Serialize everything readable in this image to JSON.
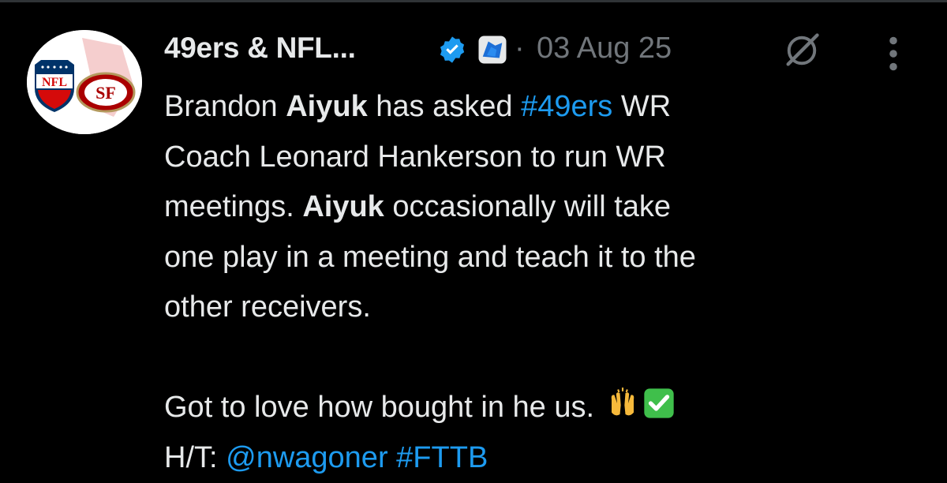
{
  "tweet": {
    "author_name": "49ers & NFL...",
    "separator": "·",
    "date": "03 Aug 25",
    "text": {
      "l1_a": "Brandon ",
      "l1_b": "Aiyuk",
      "l1_c": " has asked ",
      "l1_hashtag": "#49ers",
      "l1_d": " WR",
      "l2": "Coach Leonard Hankerson to run WR",
      "l3_a": "meetings. ",
      "l3_b": "Aiyuk",
      "l3_c": " occasionally will take",
      "l4": "one play in a meeting and teach it to the",
      "l5": "other receivers.",
      "l6": "Got to love how bought in he us.",
      "l7_a": "H/T: ",
      "l7_mention": "@nwagoner",
      "l7_hashtag": "#FTTB"
    },
    "emojis": [
      "raising-hands-emoji",
      "check-mark-button-emoji"
    ]
  },
  "avatar_logos": {
    "left_logo": "NFL",
    "right_logo": "SF"
  },
  "icons": {
    "verified": "verified-badge-icon",
    "affiliate": "affiliate-badge-icon",
    "grok": "grok-icon",
    "more": "more-vertical-icon"
  },
  "colors": {
    "background": "#000000",
    "text": "#e7e9ea",
    "secondary": "#71767b",
    "link": "#1d9bf0",
    "verified": "#1d9bf0",
    "niners_red": "#aa0000",
    "nfl_navy": "#013369"
  }
}
